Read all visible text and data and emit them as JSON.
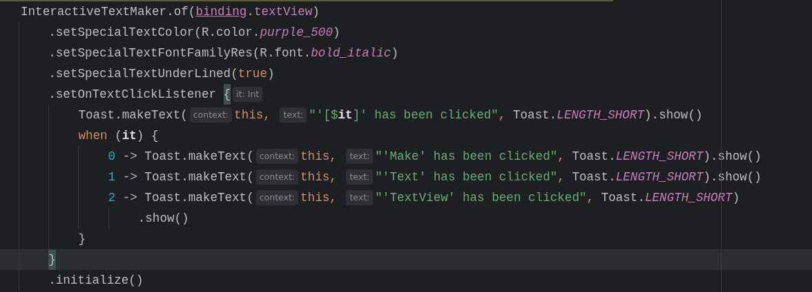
{
  "editor": {
    "lines": [
      {
        "tokens": [
          {
            "kind": "plain",
            "text": "InteractiveTextMaker.of("
          },
          {
            "kind": "field_link",
            "text": "binding"
          },
          {
            "kind": "plain",
            "text": "."
          },
          {
            "kind": "field",
            "text": "textView"
          },
          {
            "kind": "plain",
            "text": ")"
          }
        ],
        "children": [
          {
            "tokens": [
              {
                "kind": "plain",
                "text": ".setSpecialTextColor(R.color."
              },
              {
                "kind": "static",
                "text": "purple_500"
              },
              {
                "kind": "plain",
                "text": ")"
              }
            ]
          },
          {
            "tokens": [
              {
                "kind": "plain",
                "text": ".setSpecialTextFontFamilyRes(R.font."
              },
              {
                "kind": "static",
                "text": "bold_italic"
              },
              {
                "kind": "plain",
                "text": ")"
              }
            ]
          },
          {
            "tokens": [
              {
                "kind": "plain",
                "text": ".setSpecialTextUnderLined("
              },
              {
                "kind": "keyword",
                "text": "true"
              },
              {
                "kind": "plain",
                "text": ")"
              }
            ]
          },
          {
            "tokens": [
              {
                "kind": "plain",
                "text": ".setOnTextClickListener "
              },
              {
                "kind": "brace_match",
                "text": "{"
              },
              {
                "kind": "hint",
                "text": "it: Int"
              }
            ],
            "children": [
              {
                "tokens": [
                  {
                    "kind": "plain",
                    "text": "Toast.makeText("
                  },
                  {
                    "kind": "hint",
                    "text": "context:"
                  },
                  {
                    "kind": "keyword",
                    "text": "this, "
                  },
                  {
                    "kind": "hint",
                    "text": "text:"
                  },
                  {
                    "kind": "string",
                    "text": "\"'[$"
                  },
                  {
                    "kind": "bold",
                    "text": "it"
                  },
                  {
                    "kind": "string",
                    "text": "]' has been clicked\""
                  },
                  {
                    "kind": "keyword",
                    "text": ", "
                  },
                  {
                    "kind": "plain",
                    "text": "Toast."
                  },
                  {
                    "kind": "static",
                    "text": "LENGTH_SHORT"
                  },
                  {
                    "kind": "plain",
                    "text": ").show()"
                  }
                ]
              },
              {
                "tokens": [
                  {
                    "kind": "keyword",
                    "text": "when "
                  },
                  {
                    "kind": "plain",
                    "text": "("
                  },
                  {
                    "kind": "bold",
                    "text": "it"
                  },
                  {
                    "kind": "plain",
                    "text": ") {"
                  }
                ],
                "children": [
                  {
                    "tokens": [
                      {
                        "kind": "number",
                        "text": "0"
                      },
                      {
                        "kind": "plain",
                        "text": " -> Toast.makeText("
                      },
                      {
                        "kind": "hint",
                        "text": "context:"
                      },
                      {
                        "kind": "keyword",
                        "text": "this, "
                      },
                      {
                        "kind": "hint",
                        "text": "text:"
                      },
                      {
                        "kind": "string",
                        "text": "\"'Make' has been clicked\""
                      },
                      {
                        "kind": "keyword",
                        "text": ", "
                      },
                      {
                        "kind": "plain",
                        "text": "Toast."
                      },
                      {
                        "kind": "static",
                        "text": "LENGTH_SHORT"
                      },
                      {
                        "kind": "plain",
                        "text": ").show()"
                      }
                    ]
                  },
                  {
                    "tokens": [
                      {
                        "kind": "number",
                        "text": "1"
                      },
                      {
                        "kind": "plain",
                        "text": " -> Toast.makeText("
                      },
                      {
                        "kind": "hint",
                        "text": "context:"
                      },
                      {
                        "kind": "keyword",
                        "text": "this, "
                      },
                      {
                        "kind": "hint",
                        "text": "text:"
                      },
                      {
                        "kind": "string",
                        "text": "\"'Text' has been clicked\""
                      },
                      {
                        "kind": "keyword",
                        "text": ", "
                      },
                      {
                        "kind": "plain",
                        "text": "Toast."
                      },
                      {
                        "kind": "static",
                        "text": "LENGTH_SHORT"
                      },
                      {
                        "kind": "plain",
                        "text": ").show()"
                      }
                    ]
                  },
                  {
                    "tokens": [
                      {
                        "kind": "number",
                        "text": "2"
                      },
                      {
                        "kind": "plain",
                        "text": " -> Toast.makeText("
                      },
                      {
                        "kind": "hint",
                        "text": "context:"
                      },
                      {
                        "kind": "keyword",
                        "text": "this, "
                      },
                      {
                        "kind": "hint",
                        "text": "text:"
                      },
                      {
                        "kind": "string",
                        "text": "\"'TextView' has been clicked\""
                      },
                      {
                        "kind": "keyword",
                        "text": ", "
                      },
                      {
                        "kind": "plain",
                        "text": "Toast."
                      },
                      {
                        "kind": "static",
                        "text": "LENGTH_SHORT"
                      },
                      {
                        "kind": "plain",
                        "text": ")"
                      }
                    ],
                    "children": [
                      {
                        "tokens": [
                          {
                            "kind": "plain",
                            "text": ".show()"
                          }
                        ]
                      }
                    ]
                  }
                ]
              },
              {
                "tokens": [
                  {
                    "kind": "plain",
                    "text": "}"
                  }
                ]
              }
            ]
          },
          {
            "current": true,
            "tokens": [
              {
                "kind": "brace_match",
                "text": "}"
              }
            ]
          },
          {
            "tokens": [
              {
                "kind": "plain",
                "text": ".initialize()"
              }
            ]
          }
        ]
      }
    ]
  }
}
